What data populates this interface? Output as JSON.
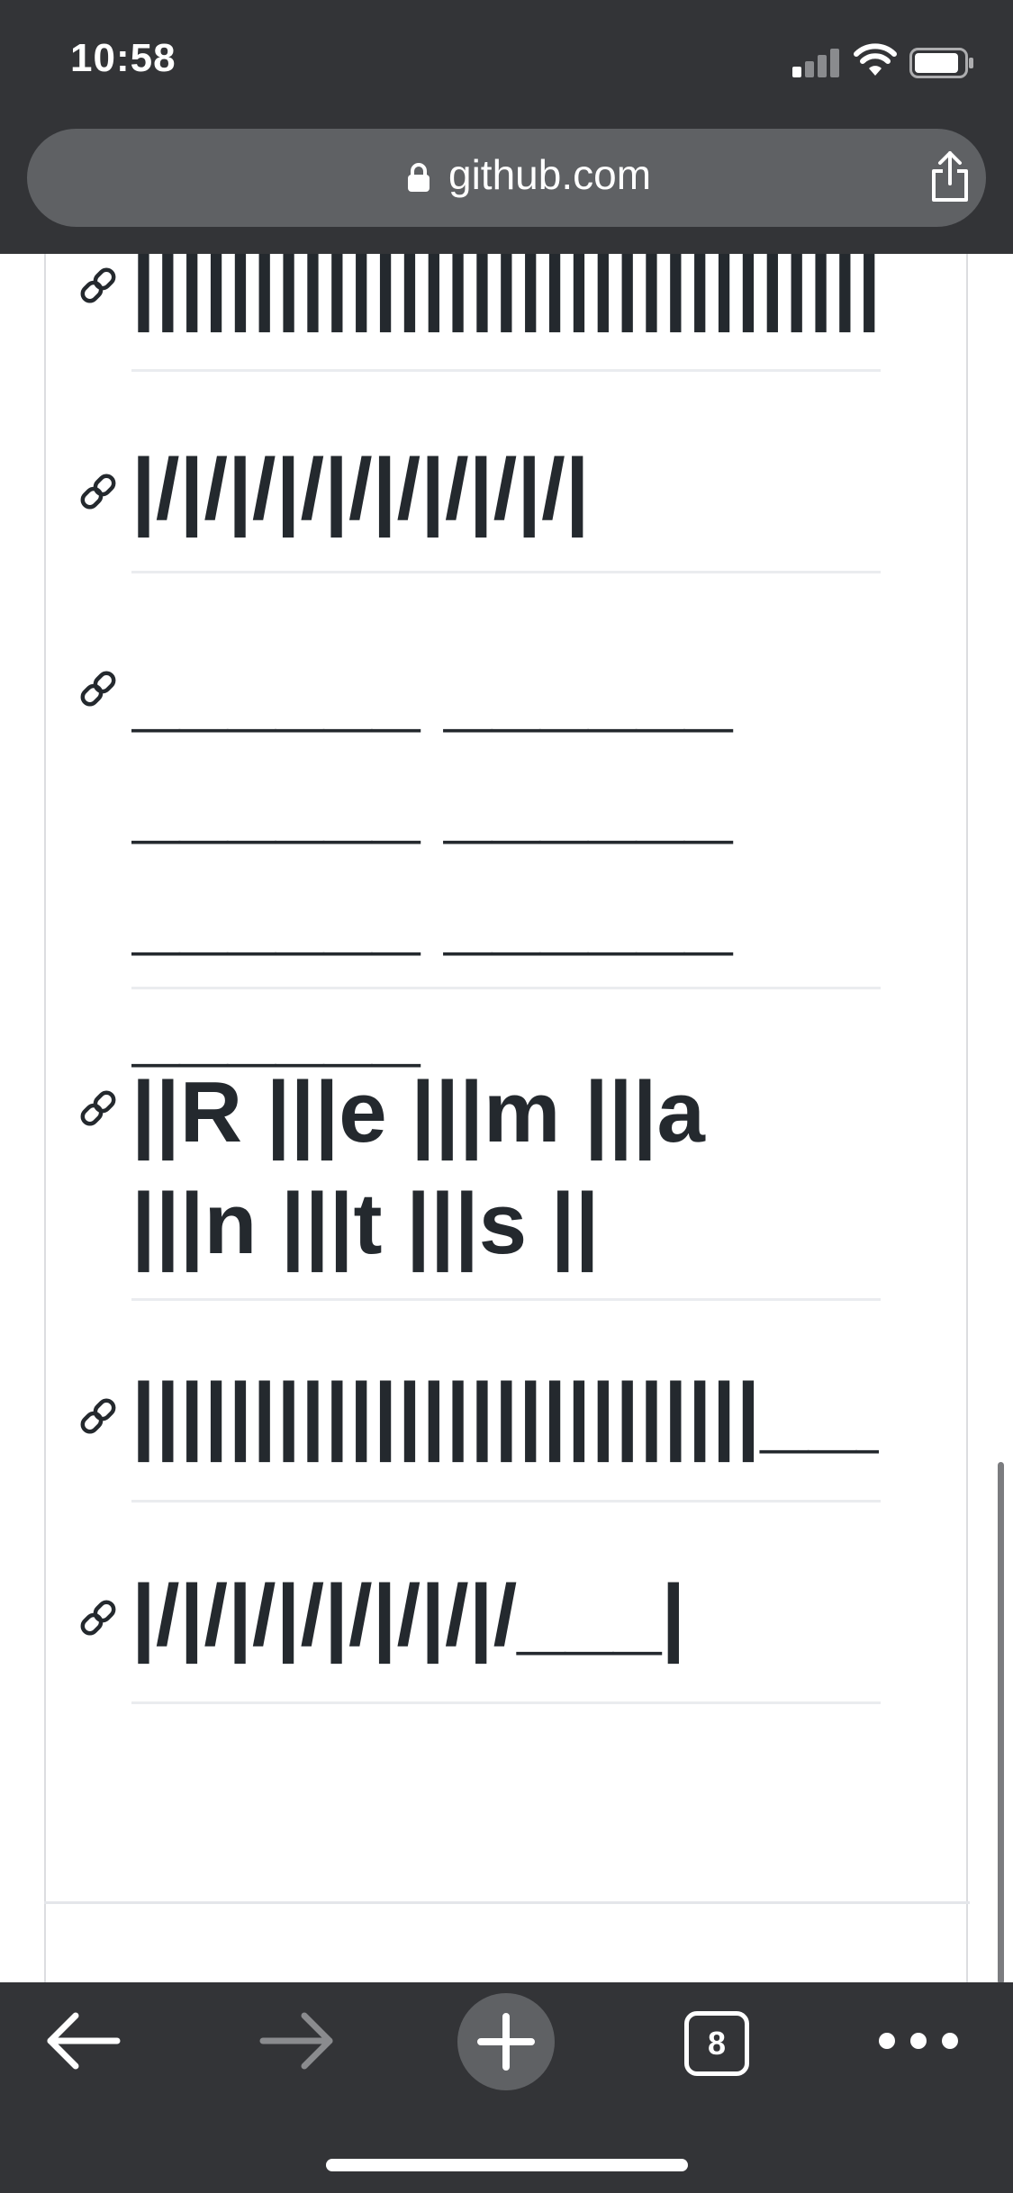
{
  "status_bar": {
    "time": "10:58"
  },
  "browser": {
    "url": "github.com",
    "tab_count": "8",
    "icons": [
      "lock-icon",
      "share-icon",
      "back-icon",
      "forward-icon",
      "plus-icon",
      "tabs-icon",
      "more-icon"
    ]
  },
  "headings": [
    "||||||||||||||||||||||||||||||||",
    "|/|/|/|/|/|/|/|/|/|",
    "______ ______ ______ ______ ______ ______ ______",
    "||R |||e |||m |||a |||n |||t |||s ||",
    "||||||||||||||||||||||||||___||",
    "|/|/|/|/|/|/|/|/___|"
  ],
  "colors": {
    "chrome": "#333437",
    "url_bar": "#5f6164",
    "text": "#24292e",
    "rule": "#eaecef"
  }
}
